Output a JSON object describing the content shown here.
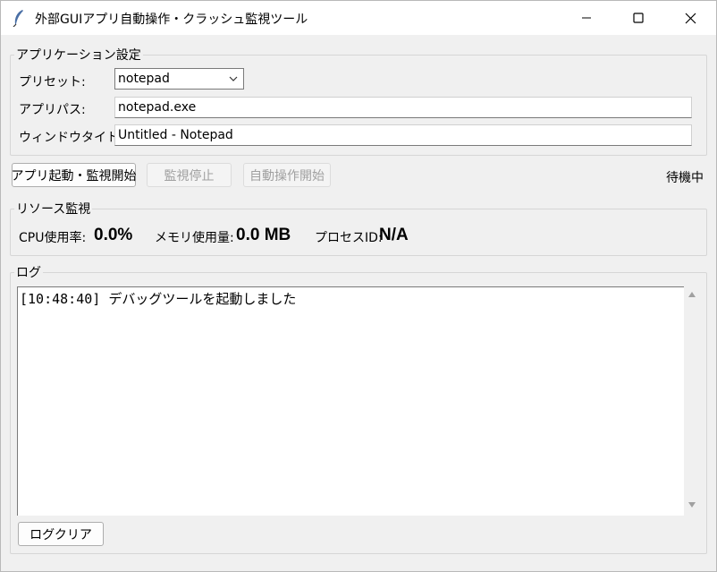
{
  "window": {
    "title": "外部GUIアプリ自動操作・クラッシュ監視ツール"
  },
  "settings": {
    "legend": "アプリケーション設定",
    "preset_label": "プリセット:",
    "preset_value": "notepad",
    "app_path_label": "アプリパス:",
    "app_path_value": "notepad.exe",
    "window_title_label": "ウィンドウタイトル:",
    "window_title_value": "Untitled - Notepad"
  },
  "controls": {
    "start_label": "アプリ起動・監視開始",
    "stop_label": "監視停止",
    "auto_label": "自動操作開始",
    "status": "待機中"
  },
  "resources": {
    "legend": "リソース監視",
    "cpu_label": "CPU使用率:",
    "cpu_value": "0.0%",
    "mem_label": "メモリ使用量:",
    "mem_value": "0.0 MB",
    "pid_label": "プロセスID:",
    "pid_value": "N/A"
  },
  "log": {
    "legend": "ログ",
    "lines": [
      "[10:48:40] デバッグツールを起動しました"
    ],
    "clear_label": "ログクリア"
  },
  "icons": {
    "app": "feather-icon",
    "minimize": "minimize-icon",
    "maximize": "maximize-icon",
    "close": "close-icon"
  }
}
